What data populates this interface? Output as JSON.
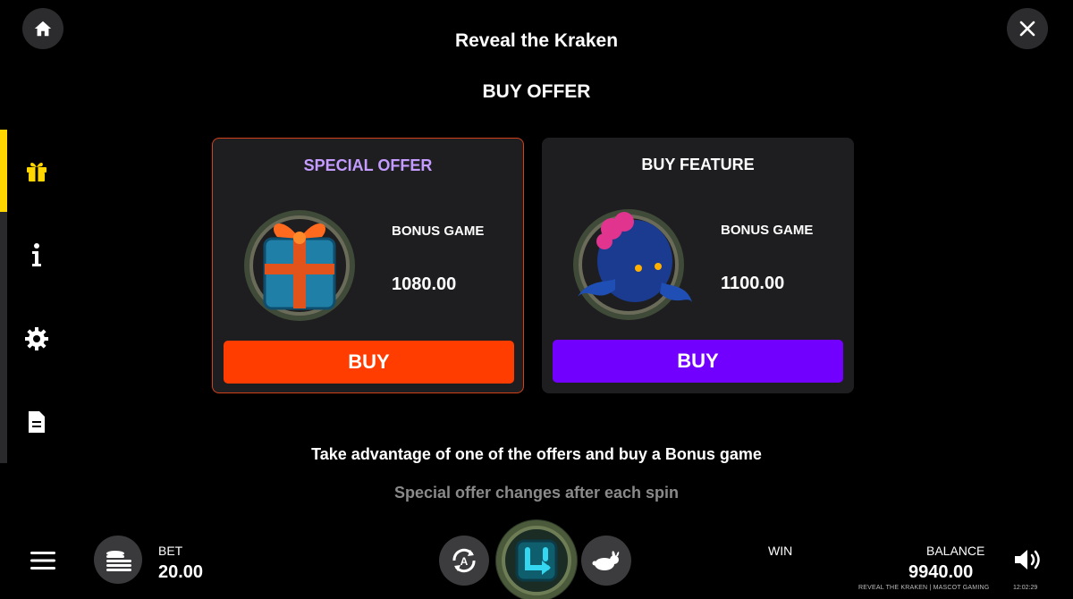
{
  "header": {
    "title": "Reveal the Kraken",
    "section_title": "BUY OFFER"
  },
  "sidebar": {
    "items": [
      {
        "icon": "gift-icon",
        "active": true
      },
      {
        "icon": "info-icon",
        "active": false
      },
      {
        "icon": "gear-icon",
        "active": false
      },
      {
        "icon": "document-icon",
        "active": false
      }
    ]
  },
  "offers": {
    "special": {
      "title": "SPECIAL OFFER",
      "label": "BONUS GAME",
      "price": "1080.00",
      "buy_label": "BUY",
      "title_color": "#c49cff",
      "button_color": "#ff3d00"
    },
    "feature": {
      "title": "BUY FEATURE",
      "label": "BONUS GAME",
      "price": "1100.00",
      "buy_label": "BUY",
      "button_color": "#7200ff"
    }
  },
  "description": {
    "line1": "Take advantage of one of the offers and buy a Bonus game",
    "line2": "Special offer changes after each spin"
  },
  "bottom_bar": {
    "bet_label": "BET",
    "bet_value": "20.00",
    "win_label": "WIN",
    "balance_label": "BALANCE",
    "balance_value": "9940.00",
    "footer": "REVEAL THE KRAKEN | MASCOT GAMING",
    "clock": "12:02:29"
  },
  "colors": {
    "accent_yellow": "#ffd600",
    "background": "#000000",
    "card_bg": "#1e1e20"
  }
}
